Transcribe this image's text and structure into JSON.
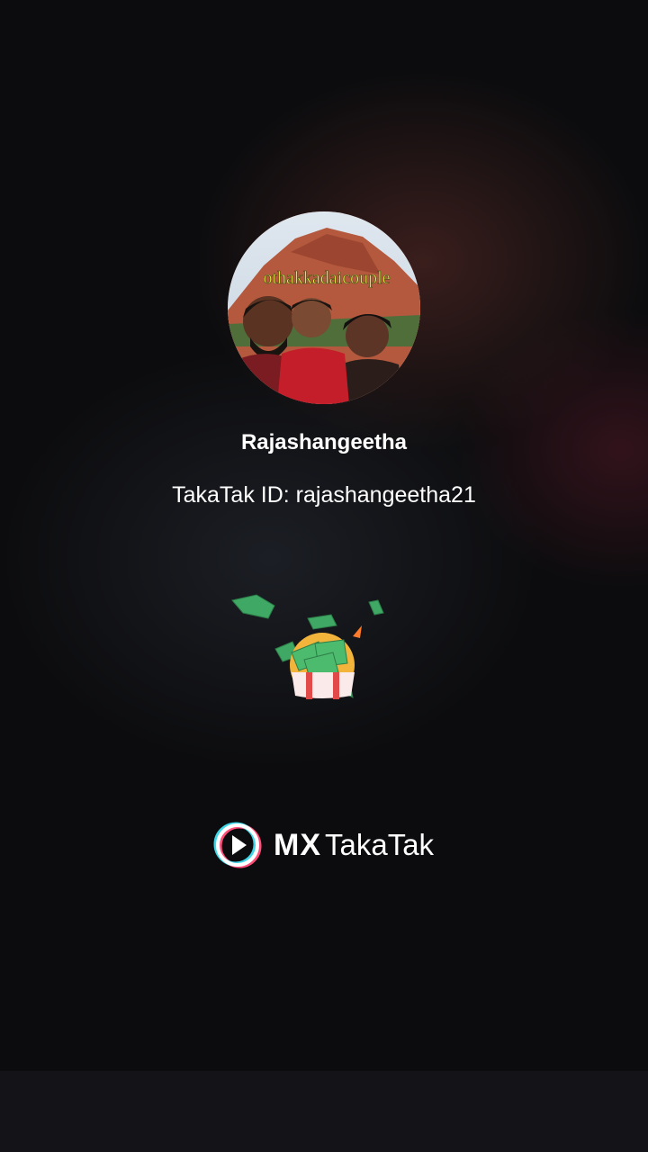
{
  "profile": {
    "avatar_caption": "othakkadaicouple",
    "username": "Rajashangeetha",
    "takatak_id": "TakaTak ID: rajashangeetha21"
  },
  "branding": {
    "logo_bold": "MX",
    "logo_regular": "TakaTak"
  },
  "icons": {
    "gift": "gift-money-icon",
    "logo": "mx-play-logo-icon"
  },
  "colors": {
    "background": "#0c0c0e",
    "text": "#ffffff",
    "caption": "#e8f04a",
    "logo_ring_cyan": "#3fd6e8",
    "logo_ring_pink": "#ff4d7a"
  }
}
